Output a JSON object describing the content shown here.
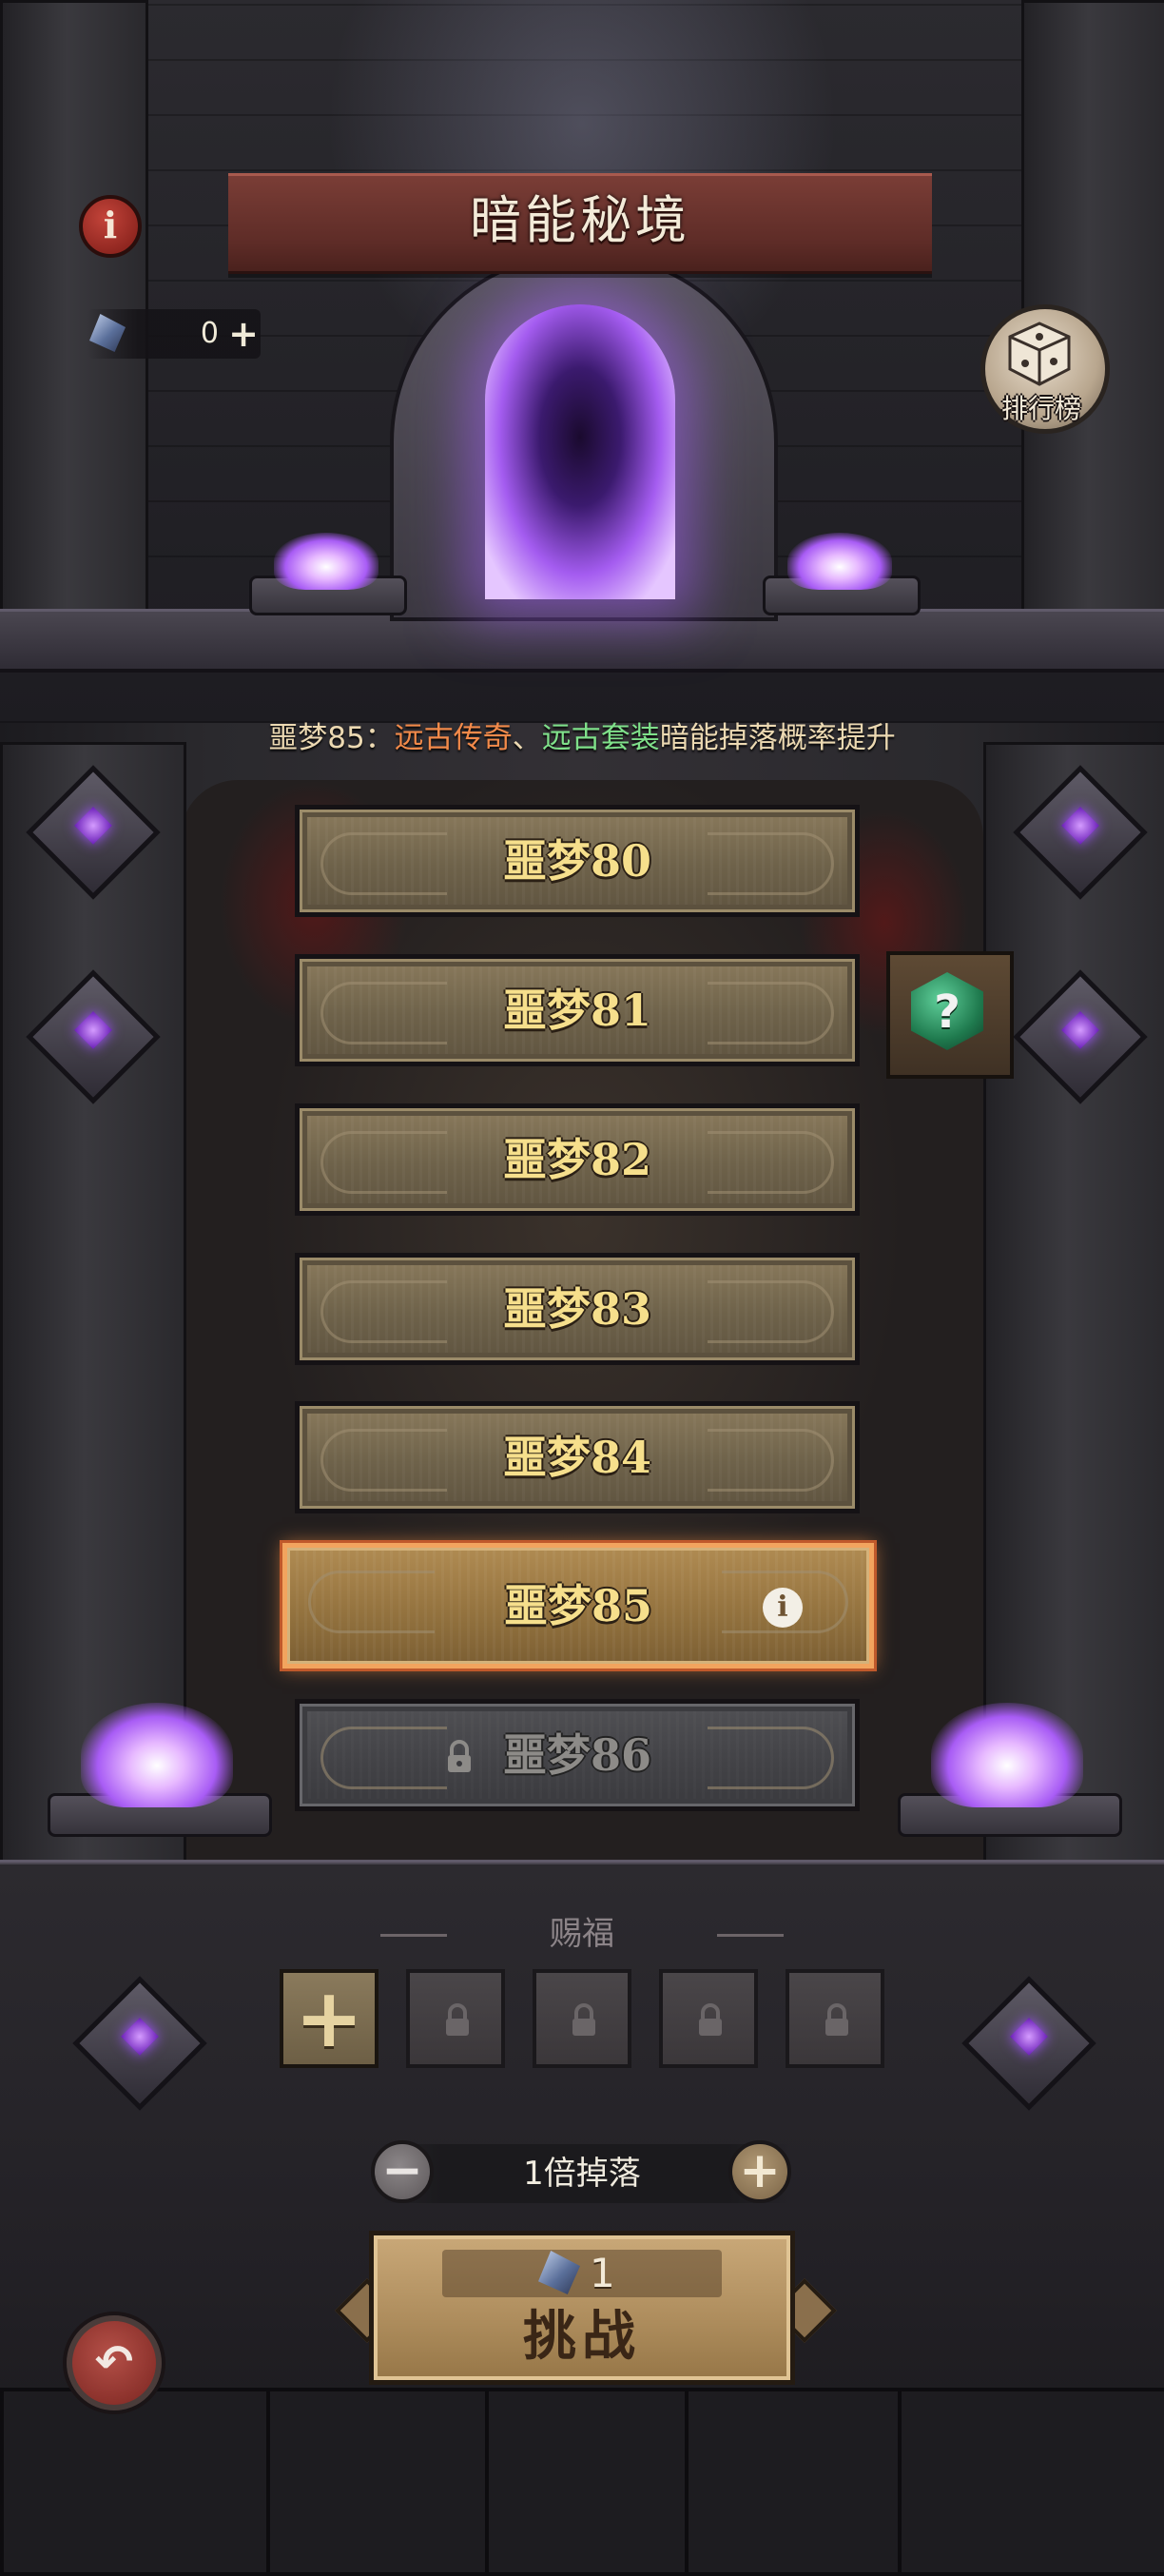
{
  "header": {
    "title": "暗能秘境",
    "info_icon_glyph": "i",
    "currency": {
      "icon": "crystal-icon",
      "value": "0",
      "add_glyph": "+"
    },
    "ranking": {
      "label": "排行榜",
      "icon": "dice-icon"
    }
  },
  "notice": {
    "prefix": "噩梦85：",
    "item1": "远古传奇",
    "sep": "、",
    "item2": "远古套装",
    "suffix": "暗能掉落概率提升"
  },
  "levels": [
    {
      "label": "噩梦80",
      "state": "normal"
    },
    {
      "label": "噩梦81",
      "state": "normal"
    },
    {
      "label": "噩梦82",
      "state": "normal"
    },
    {
      "label": "噩梦83",
      "state": "normal"
    },
    {
      "label": "噩梦84",
      "state": "normal"
    },
    {
      "label": "噩梦85",
      "state": "selected"
    },
    {
      "label": "噩梦86",
      "state": "locked"
    }
  ],
  "selected_info_glyph": "i",
  "mystery": {
    "glyph": "?"
  },
  "blessing": {
    "title": "赐福",
    "add_glyph": "+",
    "slots": [
      "add",
      "locked",
      "locked",
      "locked",
      "locked"
    ]
  },
  "multiplier": {
    "label": "1倍掉落",
    "minus_glyph": "−",
    "plus_glyph": "+"
  },
  "challenge": {
    "cost": "1",
    "label": "挑战"
  },
  "back": {
    "glyph": "↶"
  },
  "colors": {
    "banner": "#6a322c",
    "level_text": "#f6df8c",
    "selected_border": "#f2a45e",
    "notice_highlight_1": "#f28a4a",
    "notice_highlight_2": "#7fe08a"
  }
}
